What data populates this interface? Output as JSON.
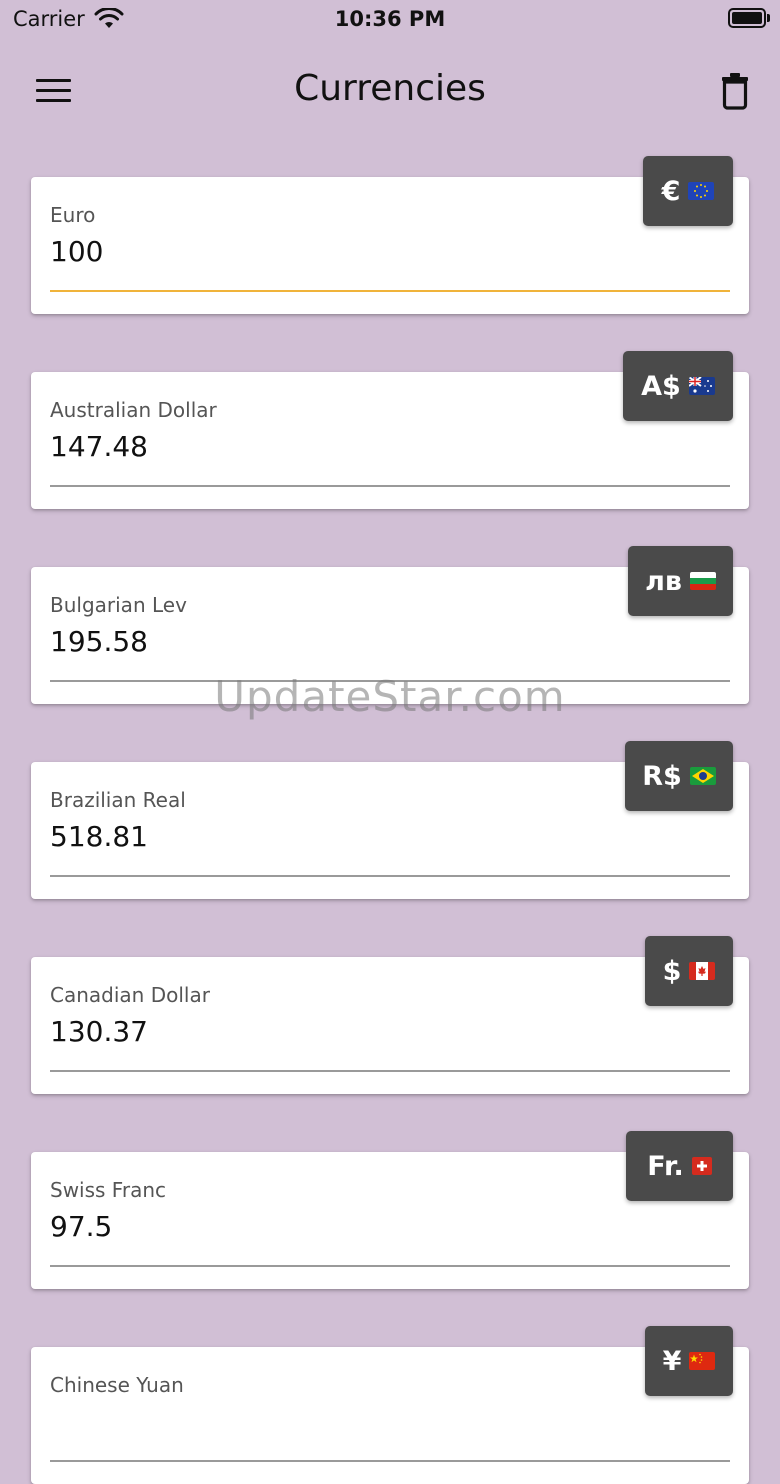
{
  "status_bar": {
    "carrier": "Carrier",
    "time": "10:36 PM"
  },
  "app_bar": {
    "title": "Currencies"
  },
  "icons": {
    "menu": "menu-icon",
    "trash": "trash-icon",
    "wifi": "wifi-icon",
    "battery": "battery-icon"
  },
  "colors": {
    "background": "#d1bfd5",
    "card": "#ffffff",
    "badge": "#4a4a4a",
    "active_underline": "#f0b33a"
  },
  "currencies": [
    {
      "name": "Euro",
      "value": "100",
      "symbol": "€",
      "flag": "eu-flag-icon",
      "active": true
    },
    {
      "name": "Australian Dollar",
      "value": "147.48",
      "symbol": "A$",
      "flag": "au-flag-icon",
      "active": false
    },
    {
      "name": "Bulgarian Lev",
      "value": "195.58",
      "symbol": "лв",
      "flag": "bg-flag-icon",
      "active": false
    },
    {
      "name": "Brazilian Real",
      "value": "518.81",
      "symbol": "R$",
      "flag": "br-flag-icon",
      "active": false
    },
    {
      "name": "Canadian Dollar",
      "value": "130.37",
      "symbol": "$",
      "flag": "ca-flag-icon",
      "active": false
    },
    {
      "name": "Swiss Franc",
      "value": "97.5",
      "symbol": "Fr.",
      "flag": "ch-flag-icon",
      "active": false
    },
    {
      "name": "Chinese Yuan",
      "value": "",
      "symbol": "¥",
      "flag": "cn-flag-icon",
      "active": false
    }
  ],
  "watermark": "UpdateStar.com"
}
